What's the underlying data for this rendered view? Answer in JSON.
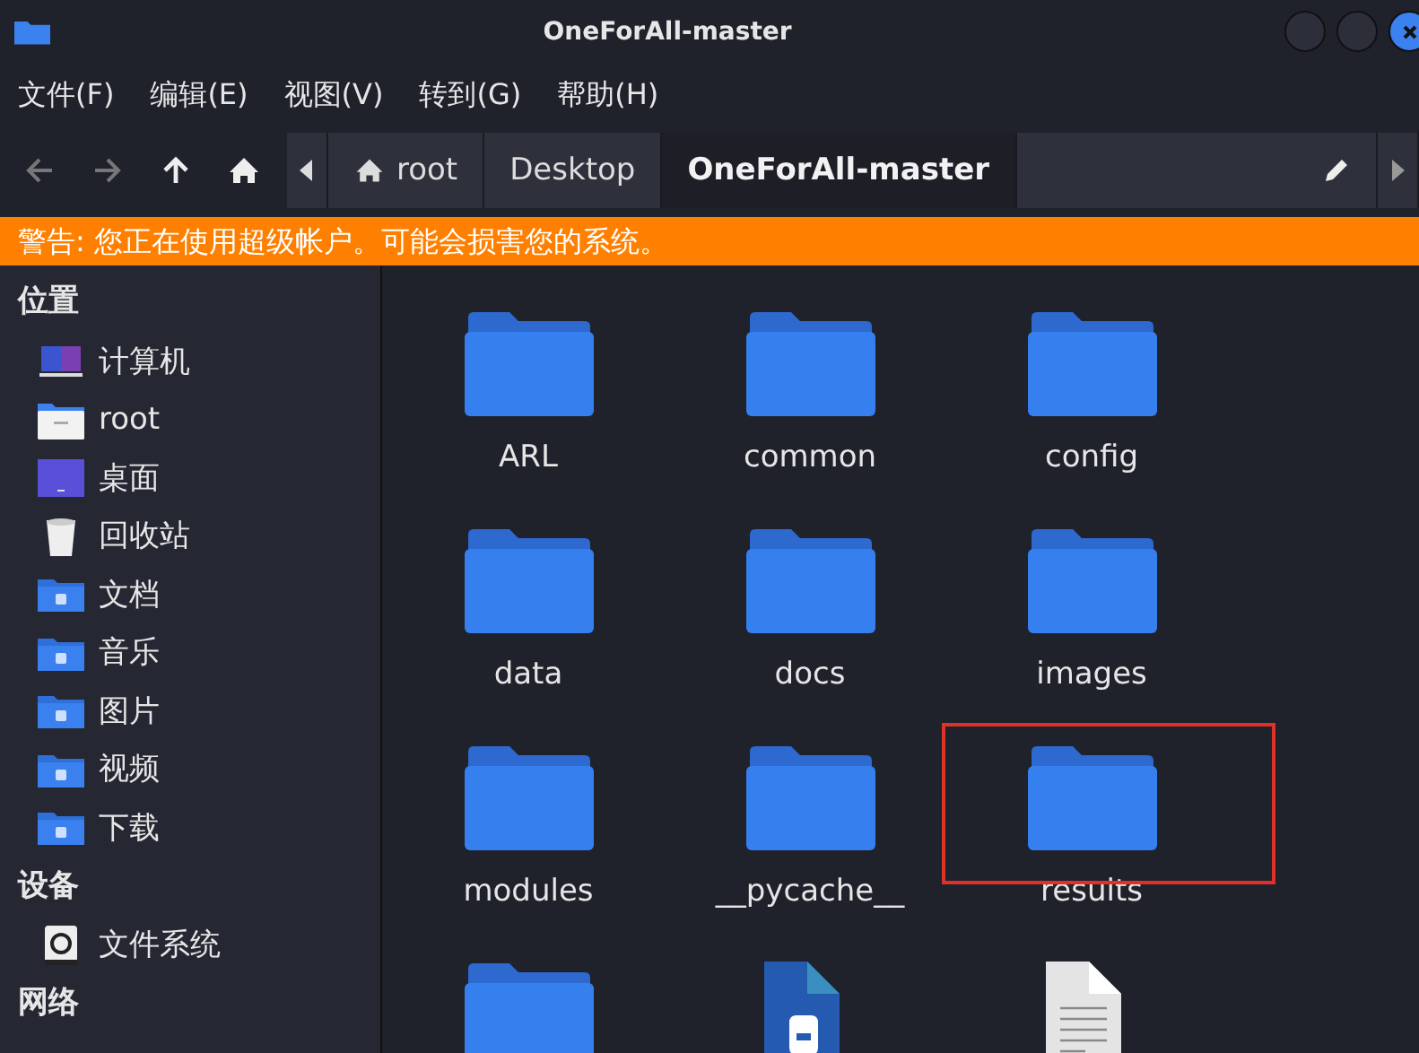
{
  "window": {
    "title": "OneForAll-master"
  },
  "menu": [
    "文件(F)",
    "编辑(E)",
    "视图(V)",
    "转到(G)",
    "帮助(H)"
  ],
  "path": [
    {
      "label": "root",
      "kind": "home",
      "selected": false
    },
    {
      "label": "Desktop",
      "kind": "plain",
      "selected": false
    },
    {
      "label": "OneForAll-master",
      "kind": "plain",
      "selected": true
    }
  ],
  "warning": "警告: 您正在使用超级帐户。可能会损害您的系统。",
  "sidebar": [
    {
      "heading": "位置",
      "items": [
        {
          "label": "计算机",
          "kind": "computer"
        },
        {
          "label": "root",
          "kind": "home"
        },
        {
          "label": "桌面",
          "kind": "desktop"
        },
        {
          "label": "回收站",
          "kind": "trash"
        },
        {
          "label": "文档",
          "kind": "documents"
        },
        {
          "label": "音乐",
          "kind": "music"
        },
        {
          "label": "图片",
          "kind": "pictures"
        },
        {
          "label": "视频",
          "kind": "videos"
        },
        {
          "label": "下载",
          "kind": "downloads"
        }
      ]
    },
    {
      "heading": "设备",
      "items": [
        {
          "label": "文件系统",
          "kind": "drive"
        }
      ]
    },
    {
      "heading": "网络"
    }
  ],
  "files": [
    {
      "label": "ARL",
      "kind": "folder",
      "highlighted": false
    },
    {
      "label": "common",
      "kind": "folder",
      "highlighted": false
    },
    {
      "label": "config",
      "kind": "folder",
      "highlighted": false
    },
    {
      "label": "data",
      "kind": "folder",
      "highlighted": false
    },
    {
      "label": "docs",
      "kind": "folder",
      "highlighted": false
    },
    {
      "label": "images",
      "kind": "folder",
      "highlighted": false
    },
    {
      "label": "modules",
      "kind": "folder",
      "highlighted": false
    },
    {
      "label": "__pycache__",
      "kind": "folder",
      "highlighted": false
    },
    {
      "label": "results",
      "kind": "folder",
      "highlighted": true
    },
    {
      "kind": "folder",
      "highlighted": false
    },
    {
      "kind": "python",
      "highlighted": false
    },
    {
      "kind": "text",
      "highlighted": false
    }
  ]
}
